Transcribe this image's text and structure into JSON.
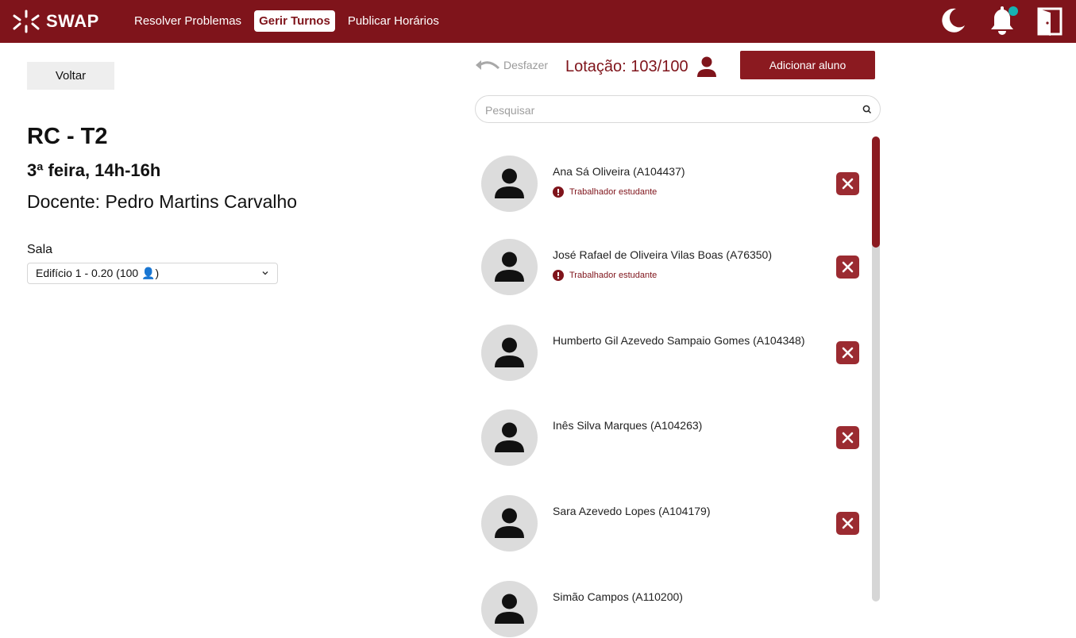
{
  "app": {
    "name": "SWAP"
  },
  "nav": [
    {
      "label": "Resolver Problemas",
      "active": false
    },
    {
      "label": "Gerir Turnos",
      "active": true
    },
    {
      "label": "Publicar Horários",
      "active": false
    }
  ],
  "topbar_icons": [
    "moon-icon",
    "bell-icon",
    "logout-icon"
  ],
  "colors": {
    "brand": "#7f141b",
    "notification_dot": "#17b3b3"
  },
  "back_label": "Voltar",
  "shift": {
    "title": "RC - T2",
    "time": "3ª feira, 14h-16h",
    "teacher": "Docente: Pedro Martins Carvalho"
  },
  "room": {
    "label": "Sala",
    "selected": "Edifício 1 - 0.20 (100 👤)"
  },
  "undo_label": "Desfazer",
  "capacity": "Lotação: 103/100",
  "add_label": "Adicionar aluno",
  "search": {
    "placeholder": "Pesquisar",
    "value": ""
  },
  "students": [
    {
      "name": "Ana Sá Oliveira (A104437)",
      "badge": "Trabalhador estudante"
    },
    {
      "name": "José Rafael de Oliveira Vilas Boas (A76350)",
      "badge": "Trabalhador estudante"
    },
    {
      "name": "Humberto Gil Azevedo Sampaio Gomes (A104348)",
      "badge": ""
    },
    {
      "name": "Inês Silva Marques (A104263)",
      "badge": ""
    },
    {
      "name": "Sara Azevedo Lopes (A104179)",
      "badge": ""
    },
    {
      "name": "Simão Campos (A110200)",
      "badge": ""
    }
  ]
}
